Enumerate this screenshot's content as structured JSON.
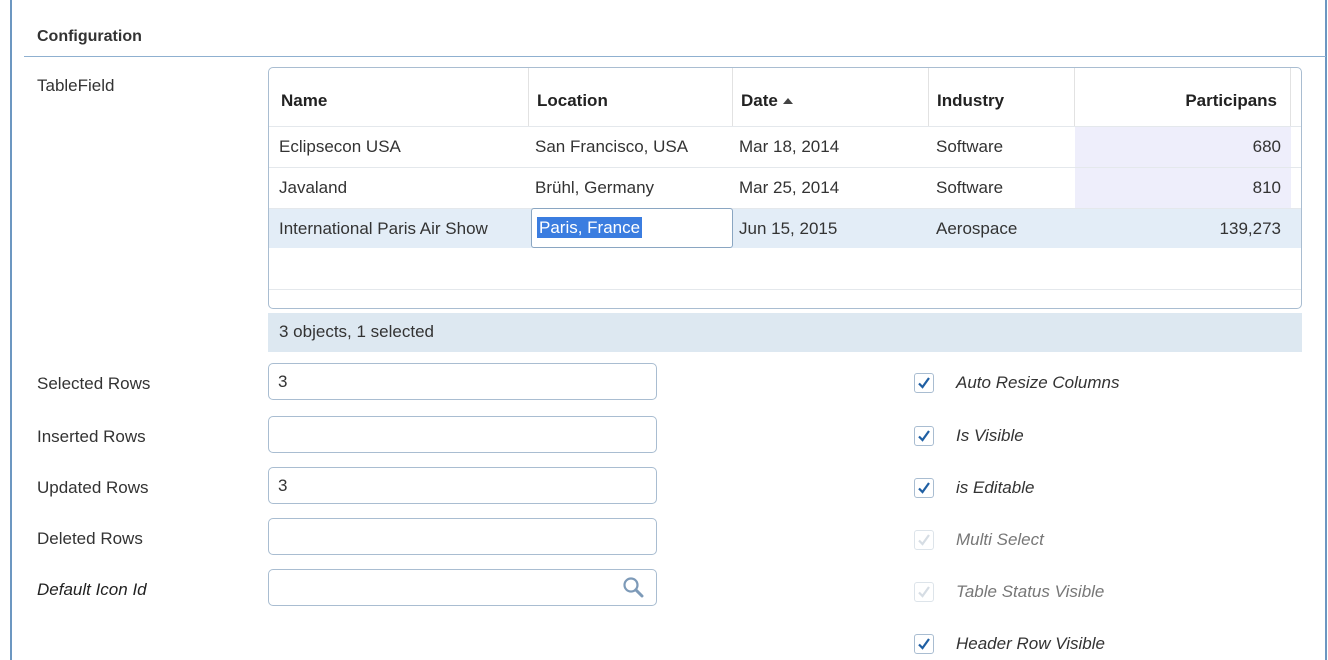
{
  "section": {
    "title": "Configuration"
  },
  "table_field": {
    "label": "TableField",
    "columns": [
      "Name",
      "Location",
      "Date",
      "Industry",
      "Participans"
    ],
    "sort_column": "Date",
    "rows": [
      {
        "name": "Eclipsecon USA",
        "location": "San Francisco, USA",
        "date": "Mar 18, 2014",
        "industry": "Software",
        "participants": "680"
      },
      {
        "name": "Javaland",
        "location": "Brühl, Germany",
        "date": "Mar 25, 2014",
        "industry": "Software",
        "participants": "810"
      },
      {
        "name": "International Paris Air Show",
        "location": "Paris, France",
        "date": "Jun 15, 2015",
        "industry": "Aerospace",
        "participants": "139,273"
      }
    ],
    "editing_value": "Paris, France",
    "status": "3 objects, 1 selected"
  },
  "fields": {
    "selected_rows": {
      "label": "Selected Rows",
      "value": "3"
    },
    "inserted_rows": {
      "label": "Inserted Rows",
      "value": ""
    },
    "updated_rows": {
      "label": "Updated Rows",
      "value": "3"
    },
    "deleted_rows": {
      "label": "Deleted Rows",
      "value": ""
    },
    "default_icon_id": {
      "label": "Default Icon Id",
      "value": ""
    }
  },
  "options": {
    "auto_resize_columns": {
      "label": "Auto Resize Columns",
      "checked": true,
      "enabled": true
    },
    "is_visible": {
      "label": "Is Visible",
      "checked": true,
      "enabled": true
    },
    "is_editable": {
      "label": "is Editable",
      "checked": true,
      "enabled": true
    },
    "multi_select": {
      "label": "Multi Select",
      "checked": true,
      "enabled": false
    },
    "table_status_visible": {
      "label": "Table Status Visible",
      "checked": true,
      "enabled": false
    },
    "header_row_visible": {
      "label": "Header Row Visible",
      "checked": true,
      "enabled": true
    }
  },
  "colors": {
    "accent_border": "#6c97c1",
    "selected_row": "#e3edf7",
    "status_bar": "#dde8f1",
    "text_selection": "#3b7de0"
  }
}
